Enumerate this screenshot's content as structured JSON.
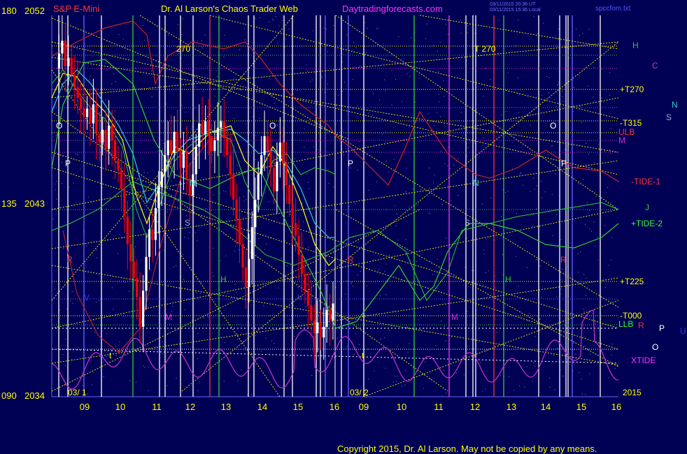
{
  "header": {
    "instrument": "S&P E-Mini",
    "site_title": "Dr. Al Larson's Chaos Trader Web",
    "site_url": "Daytradingforecasts.com",
    "timestamp_1": "03/11/2015 20:36 UT",
    "timestamp_2": "03/11/2015 15:36 Local",
    "chart_file": "spccfom.txt"
  },
  "footer": {
    "copyright": "Copyright 2015, Dr. Al Larson. May not be copied by any means."
  },
  "colors": {
    "background": "#000055",
    "grid_yellow": "#ffff00",
    "price_up": "#ffffff",
    "price_down": "#ff0000",
    "xtide": "#cc33cc",
    "tide1": "#cc2222",
    "tide2": "#33cc33",
    "ma_cyan": "#33cccc",
    "ma_yellow": "#ffff00"
  },
  "chart_data": {
    "type": "candlestick",
    "y_axis_labels": [
      {
        "angle": "180",
        "price": "2052"
      },
      {
        "angle": "135",
        "price": "2043"
      },
      {
        "angle": "090",
        "price": "2034"
      }
    ],
    "ylim": [
      2034,
      2052
    ],
    "x_tick_labels": [
      "09",
      "10",
      "11",
      "12",
      "13",
      "14",
      "15",
      "16",
      "09",
      "10",
      "11",
      "12",
      "13",
      "14",
      "15",
      "16"
    ],
    "date_labels": [
      "03/ 1",
      "03/ 2"
    ],
    "year_label": "2015",
    "right_labels": [
      {
        "text": "H",
        "color": "#33cc33"
      },
      {
        "text": "C",
        "color": "#cc33cc"
      },
      {
        "text": "+T270",
        "color": "#ffff00"
      },
      {
        "text": "N",
        "color": "#33cccc"
      },
      {
        "text": "S",
        "color": "#aaaacc"
      },
      {
        "text": "-T315",
        "color": "#ffff00"
      },
      {
        "text": "ULB",
        "color": "#ff3333"
      },
      {
        "text": "M",
        "color": "#cc33cc"
      },
      {
        "text": "-TIDE-1",
        "color": "#ff3333"
      },
      {
        "text": "J",
        "color": "#33cc33"
      },
      {
        "text": "+TIDE-2",
        "color": "#33ff33"
      },
      {
        "text": "+T225",
        "color": "#ffff00"
      },
      {
        "text": "-T000",
        "color": "#ffff00"
      },
      {
        "text": "LLB",
        "color": "#33ff33"
      },
      {
        "text": "R",
        "color": "#ff3333"
      },
      {
        "text": "P",
        "color": "#ffffff"
      },
      {
        "text": "U",
        "color": "#3333ff"
      },
      {
        "text": "O",
        "color": "#ffffff"
      },
      {
        "text": "XTIDE",
        "color": "#ff33ff"
      }
    ],
    "chart_annotations": [
      "270",
      "T 270",
      "O",
      "P",
      "N",
      "S",
      "R",
      "H",
      "M",
      "V",
      "t"
    ],
    "price_series_session1": [
      2049.5,
      2050.2,
      2050.8,
      2049.6,
      2050.0,
      2049.2,
      2048.6,
      2048.1,
      2047.6,
      2047.2,
      2047.6,
      2046.9,
      2047.8,
      2046.4,
      2046.0,
      2046.6,
      2045.7,
      2046.8,
      2046.1,
      2045.2,
      2044.7,
      2043.8,
      2042.5,
      2041.2,
      2040.4,
      2039.6,
      2038.7,
      2037.3,
      2039.0,
      2040.6,
      2041.9,
      2041.4,
      2042.9,
      2043.9,
      2044.6,
      2045.4,
      2046.1,
      2045.5,
      2046.5,
      2045.6,
      2044.8,
      2045.6,
      2044.3,
      2043.5,
      2044.5,
      2045.8,
      2046.9,
      2046.4,
      2047.0,
      2046.3,
      2045.6,
      2046.1,
      2046.7,
      2047.0,
      2046.2,
      2045.4,
      2044.5,
      2043.3,
      2042.4,
      2041.2,
      2040.1,
      2039.2,
      2040.5,
      2042.0,
      2043.3,
      2044.5,
      2045.4,
      2046.3,
      2045.6,
      2044.8,
      2043.7,
      2045.1,
      2046.0,
      2045.0,
      2044.0,
      2043.1,
      2042.2,
      2041.6,
      2040.7,
      2039.8,
      2039.0,
      2038.3,
      2037.6,
      2037.0,
      2037.5,
      2036.8,
      2037.3,
      2038.1,
      2037.6,
      2038.4
    ]
  }
}
